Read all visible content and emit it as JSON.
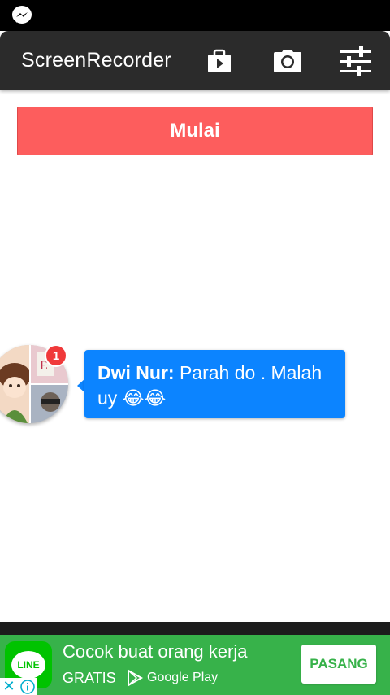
{
  "status_bar": {
    "icon": "messenger-icon"
  },
  "app_bar": {
    "title": "ScreenRecorder",
    "actions": [
      {
        "icon": "store-play-icon"
      },
      {
        "icon": "camera-icon"
      },
      {
        "icon": "sliders-settings-icon"
      }
    ]
  },
  "main": {
    "start_label": "Mulai"
  },
  "chat_head": {
    "unread_count": "1",
    "sender": "Dwi Nur:",
    "message": " Parah do . Malah uy 😂😂"
  },
  "ad": {
    "logo_text": "LINE",
    "headline": "Cocok buat orang kerja",
    "subtext": "GRATIS",
    "store_label": "Google Play",
    "cta_label": "PASANG",
    "close_symbol": "✕"
  },
  "colors": {
    "primary_button": "#fd5d5d",
    "app_bar": "#2b2b2b",
    "bubble": "#0c84ff",
    "badge": "#f0393a",
    "ad_background": "#37b24a"
  }
}
